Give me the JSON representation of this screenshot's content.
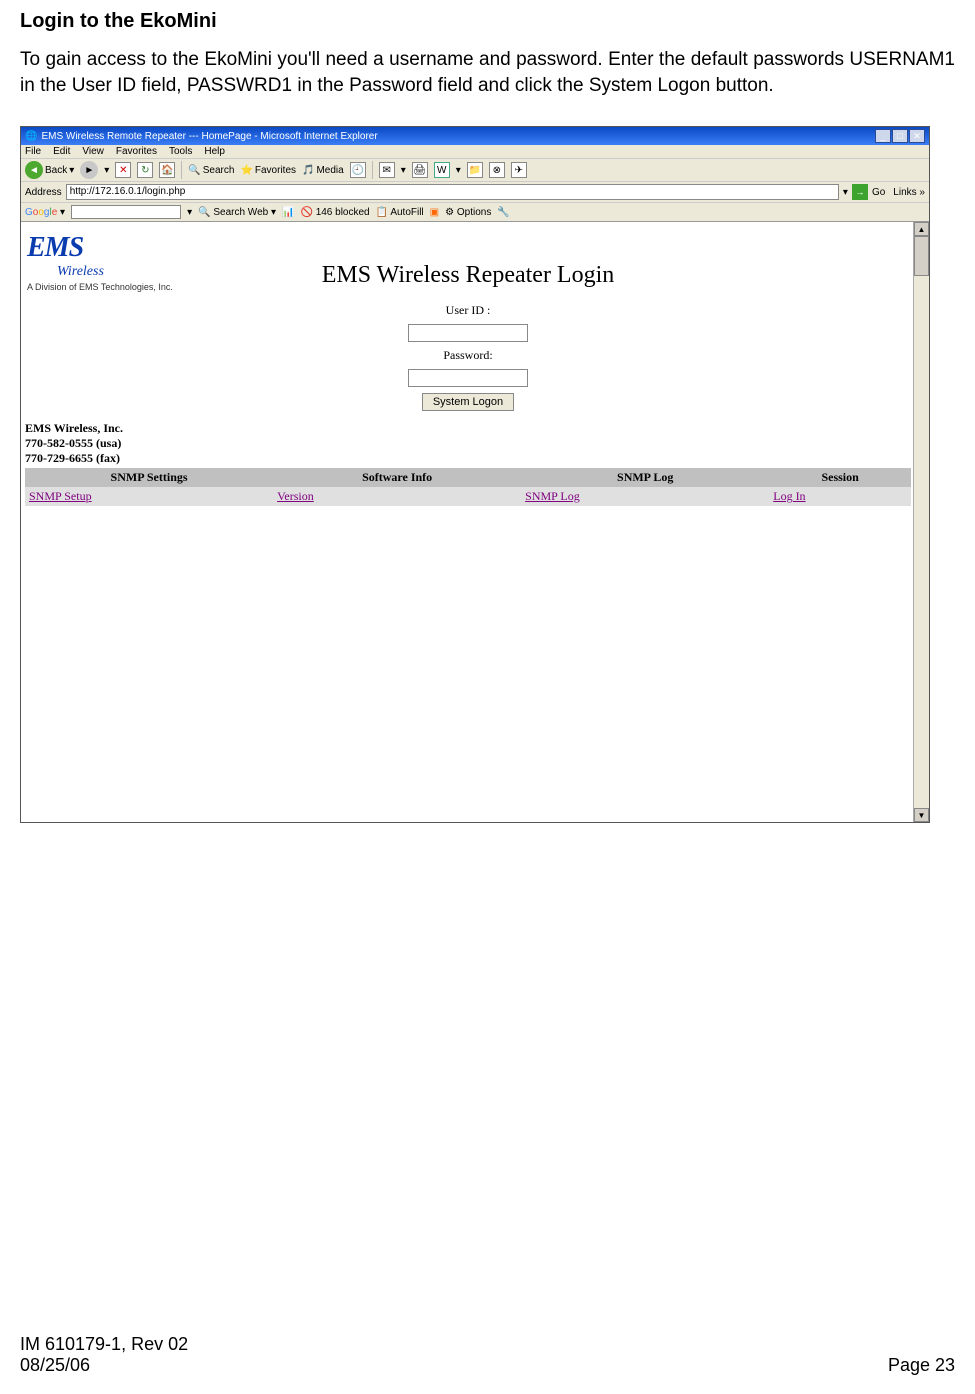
{
  "doc": {
    "section_title": "Login to the EkoMini",
    "intro_text": "To gain access to the EkoMini you'll need a username and password. Enter the default passwords USERNAM1 in the User ID field, PASSWRD1 in the Password field and click the System Logon button.",
    "footer_id": "IM 610179-1, Rev 02",
    "footer_date": "08/25/06",
    "footer_page": "Page 23"
  },
  "browser": {
    "window_title": "EMS Wireless Remote Repeater --- HomePage - Microsoft Internet Explorer",
    "menu": [
      "File",
      "Edit",
      "View",
      "Favorites",
      "Tools",
      "Help"
    ],
    "toolbar": {
      "back": "Back",
      "search": "Search",
      "favorites": "Favorites",
      "media": "Media"
    },
    "address_label": "Address",
    "address_value": "http://172.16.0.1/login.php",
    "go_label": "Go",
    "links_label": "Links",
    "google": {
      "label": "Google",
      "search_web": "Search Web",
      "blocked": "146 blocked",
      "autofill": "AutoFill",
      "options": "Options"
    }
  },
  "page": {
    "logo_main": "EMS",
    "logo_sub": "Wireless",
    "division": "A Division of EMS Technologies, Inc.",
    "title": "EMS Wireless Repeater Login",
    "user_id_label": "User ID :",
    "password_label": "Password:",
    "logon_button": "System Logon",
    "contact": {
      "company": "EMS Wireless, Inc.",
      "phone": "770-582-0555 (usa)",
      "fax": "770-729-6655 (fax)"
    },
    "nav": {
      "headers": [
        "SNMP Settings",
        "Software Info",
        "SNMP Log",
        "Session"
      ],
      "links": [
        "SNMP Setup",
        "Version",
        "SNMP Log",
        "Log In"
      ]
    }
  }
}
